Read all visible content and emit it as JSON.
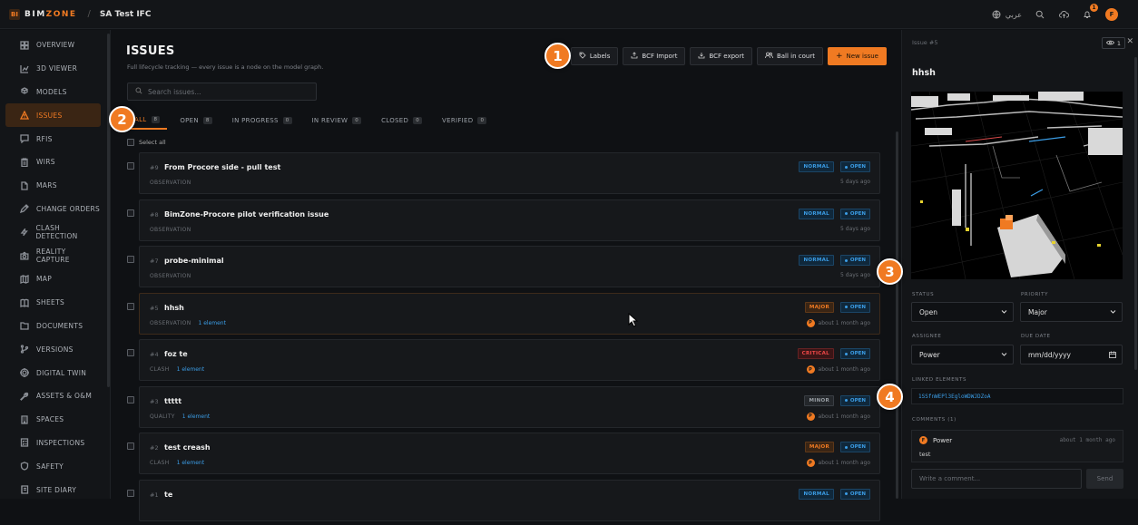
{
  "topbar": {
    "logo_mark": "BI",
    "logo_text_a": "BIM",
    "logo_text_b": "ZONE",
    "separator": "/",
    "project": "SA Test IFC",
    "lang_label": "عربي",
    "notif_count": "1",
    "avatar_initial": "F"
  },
  "sidebar": {
    "items": [
      {
        "label": "OVERVIEW",
        "icon": "grid-icon"
      },
      {
        "label": "3D VIEWER",
        "icon": "chart-icon"
      },
      {
        "label": "MODELS",
        "icon": "cubes-icon"
      },
      {
        "label": "ISSUES",
        "icon": "warning-icon",
        "active": true
      },
      {
        "label": "RFIS",
        "icon": "chat-icon"
      },
      {
        "label": "WIRS",
        "icon": "clipboard-icon"
      },
      {
        "label": "MARS",
        "icon": "file-icon"
      },
      {
        "label": "CHANGE ORDERS",
        "icon": "edit-icon"
      },
      {
        "label": "CLASH DETECTION",
        "icon": "bolt-icon"
      },
      {
        "label": "REALITY CAPTURE",
        "icon": "camera-icon"
      },
      {
        "label": "MAP",
        "icon": "map-icon"
      },
      {
        "label": "SHEETS",
        "icon": "book-icon"
      },
      {
        "label": "DOCUMENTS",
        "icon": "folder-icon"
      },
      {
        "label": "VERSIONS",
        "icon": "branch-icon"
      },
      {
        "label": "DIGITAL TWIN",
        "icon": "target-icon"
      },
      {
        "label": "ASSETS & O&M",
        "icon": "wrench-icon"
      },
      {
        "label": "SPACES",
        "icon": "building-icon"
      },
      {
        "label": "INSPECTIONS",
        "icon": "checklist-icon"
      },
      {
        "label": "SAFETY",
        "icon": "shield-icon"
      },
      {
        "label": "SITE DIARY",
        "icon": "diary-icon"
      }
    ]
  },
  "main": {
    "title": "ISSUES",
    "subtitle": "Full lifecycle tracking — every issue is a node on the model graph.",
    "actions": {
      "labels": "Labels",
      "bcf_import": "BCF Import",
      "bcf_export": "BCF export",
      "ball_in_court": "Ball in court",
      "new_issue": "New issue"
    },
    "search_placeholder": "Search issues...",
    "tabs": [
      {
        "label": "ALL",
        "count": "8"
      },
      {
        "label": "OPEN",
        "count": "8"
      },
      {
        "label": "IN PROGRESS",
        "count": "0"
      },
      {
        "label": "IN REVIEW",
        "count": "0"
      },
      {
        "label": "CLOSED",
        "count": "0"
      },
      {
        "label": "VERIFIED",
        "count": "0"
      }
    ],
    "select_all": "Select all",
    "issues": [
      {
        "num": "#9",
        "title": "From Procore side - pull test",
        "type": "OBSERVATION",
        "elements": "",
        "priority": "NORMAL",
        "pclass": "normal",
        "status": "OPEN",
        "time": "5 days ago",
        "avatar": ""
      },
      {
        "num": "#8",
        "title": "BimZone-Procore pilot verification issue",
        "type": "OBSERVATION",
        "elements": "",
        "priority": "NORMAL",
        "pclass": "normal",
        "status": "OPEN",
        "time": "5 days ago",
        "avatar": ""
      },
      {
        "num": "#7",
        "title": "probe-minimal",
        "type": "OBSERVATION",
        "elements": "",
        "priority": "NORMAL",
        "pclass": "normal",
        "status": "OPEN",
        "time": "5 days ago",
        "avatar": ""
      },
      {
        "num": "#5",
        "title": "hhsh",
        "type": "OBSERVATION",
        "elements": "1 element",
        "priority": "MAJOR",
        "pclass": "major",
        "status": "OPEN",
        "time": "about 1 month ago",
        "avatar": "P",
        "selected": true
      },
      {
        "num": "#4",
        "title": "foz te",
        "type": "CLASH",
        "elements": "1 element",
        "priority": "CRITICAL",
        "pclass": "critical",
        "status": "OPEN",
        "time": "about 1 month ago",
        "avatar": "P"
      },
      {
        "num": "#3",
        "title": "ttttt",
        "type": "QUALITY",
        "elements": "1 element",
        "priority": "MINOR",
        "pclass": "minor",
        "status": "OPEN",
        "time": "about 1 month ago",
        "avatar": "P"
      },
      {
        "num": "#2",
        "title": "test creash",
        "type": "CLASH",
        "elements": "1 element",
        "priority": "MAJOR",
        "pclass": "major",
        "status": "OPEN",
        "time": "about 1 month ago",
        "avatar": "P"
      },
      {
        "num": "#1",
        "title": "te",
        "type": "",
        "elements": "",
        "priority": "NORMAL",
        "pclass": "normal",
        "status": "OPEN",
        "time": "",
        "avatar": ""
      }
    ]
  },
  "callouts": [
    "1",
    "2",
    "3",
    "4"
  ],
  "panel": {
    "header": "Issue #5",
    "watch_count": "1",
    "title": "hhsh",
    "status_label": "STATUS",
    "status_value": "Open",
    "priority_label": "PRIORITY",
    "priority_value": "Major",
    "assignee_label": "ASSIGNEE",
    "assignee_value": "Power",
    "due_label": "DUE DATE",
    "due_value": "mm/dd/yyyy",
    "linked_label": "LINKED ELEMENTS",
    "linked_value": "1SSfnWEPl3EgloWDWJDZoA",
    "comments_label": "COMMENTS (1)",
    "comment_author": "Power",
    "comment_time": "about 1 month ago",
    "comment_text": "test",
    "comment_placeholder": "Write a comment...",
    "send_label": "Send"
  },
  "colors": {
    "accent": "#f07a22",
    "link": "#3b9de6",
    "critical": "#ef4848"
  }
}
